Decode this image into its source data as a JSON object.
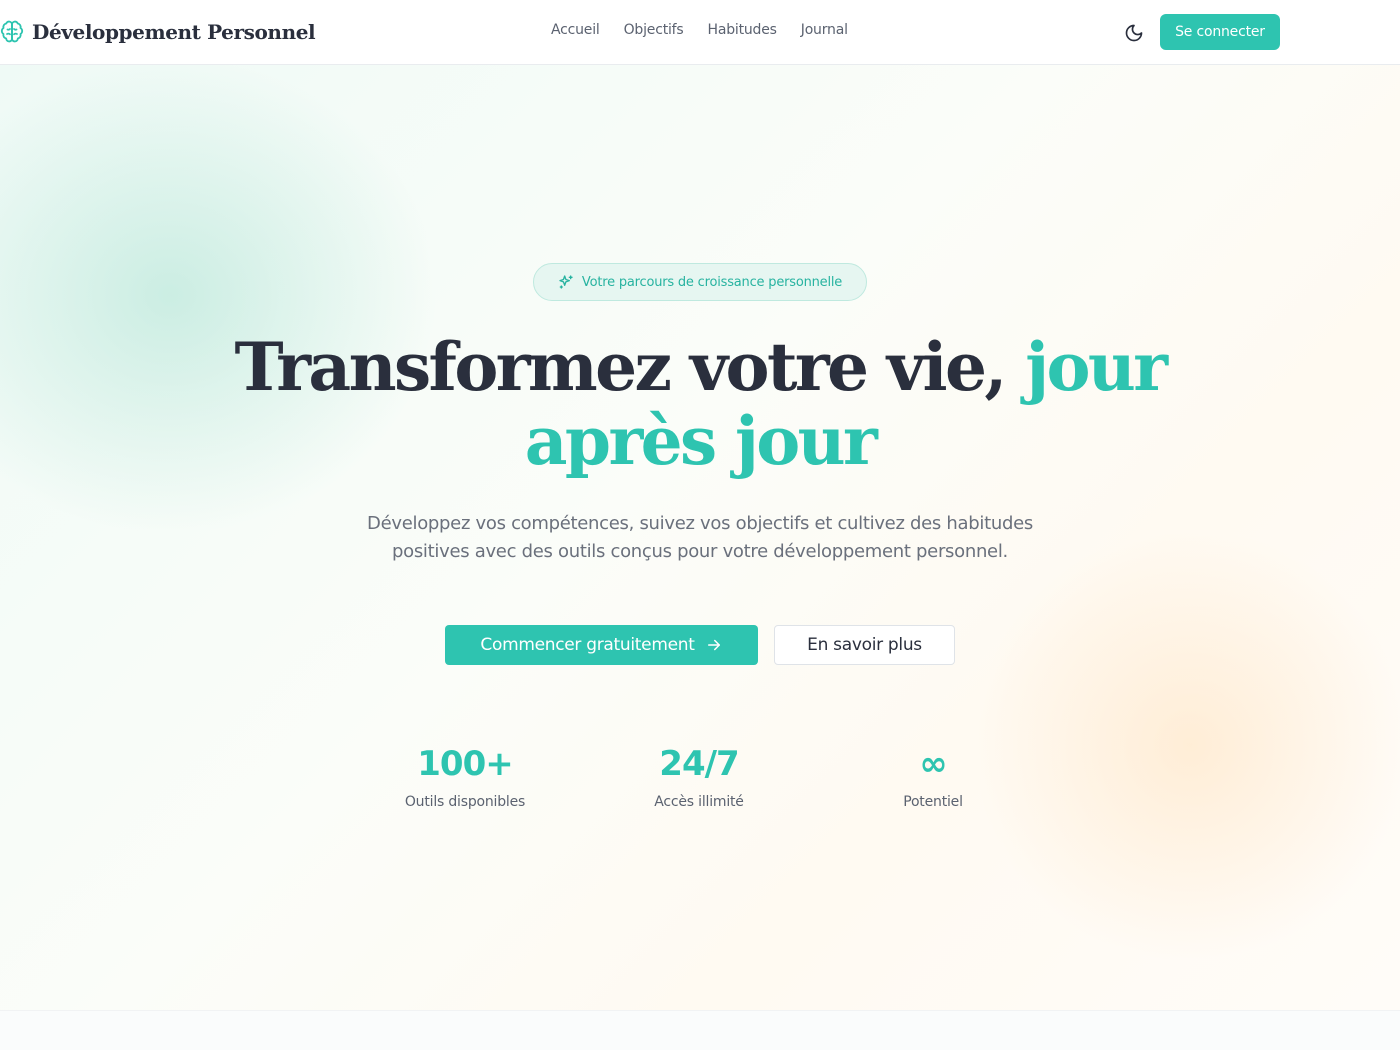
{
  "brand": {
    "name": "Développement Personnel",
    "icon": "brain-icon"
  },
  "nav": {
    "items": [
      {
        "label": "Accueil"
      },
      {
        "label": "Objectifs"
      },
      {
        "label": "Habitudes"
      },
      {
        "label": "Journal"
      }
    ]
  },
  "header": {
    "theme_toggle_icon": "moon-icon",
    "login_label": "Se connecter"
  },
  "hero": {
    "badge": {
      "icon": "sparkles-icon",
      "text": "Votre parcours de croissance personnelle"
    },
    "title_main": "Transformez votre vie, ",
    "title_accent": "jour après jour",
    "subtitle": "Développez vos compétences, suivez vos objectifs et cultivez des habitudes positives avec des outils conçus pour votre développement personnel.",
    "cta_primary": {
      "label": "Commencer gratuitement",
      "icon": "arrow-right-icon"
    },
    "cta_secondary": {
      "label": "En savoir plus"
    },
    "stats": [
      {
        "value": "100+",
        "label": "Outils disponibles"
      },
      {
        "value": "24/7",
        "label": "Accès illimité"
      },
      {
        "value": "∞",
        "label": "Potentiel"
      }
    ]
  },
  "colors": {
    "accent": "#2ec4b0",
    "text_dark": "#2a2f3d",
    "text_muted": "#6a707c"
  }
}
